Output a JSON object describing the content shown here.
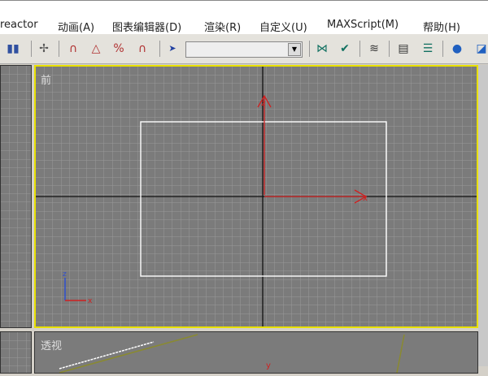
{
  "menu": [
    "reactor",
    "动画(A)",
    "图表编辑器(D)",
    "渲染(R)",
    "自定义(U)",
    "MAXScript(M)",
    "帮助(H)"
  ],
  "toolbar": {
    "icons": [
      "layer-icon",
      "bone-icon",
      "snap-3d-icon",
      "angle-snap-icon",
      "percent-snap-icon",
      "spinner-snap-icon",
      "select-by-name-icon",
      "mirror-icon",
      "align-icon",
      "layers-icon",
      "curve-editor-icon",
      "schematic-icon",
      "material-editor-icon",
      "render-icon"
    ],
    "named_selection_value": ""
  },
  "viewports": {
    "front": {
      "label": "前"
    },
    "perspective": {
      "label": "透视"
    }
  },
  "axes": {
    "x": "x",
    "y": "y",
    "z": "z"
  },
  "colors": {
    "active_border": "#e8e000",
    "viewport_bg": "#7b7b7b",
    "grid": "#999999",
    "axis_red": "#d02020"
  }
}
